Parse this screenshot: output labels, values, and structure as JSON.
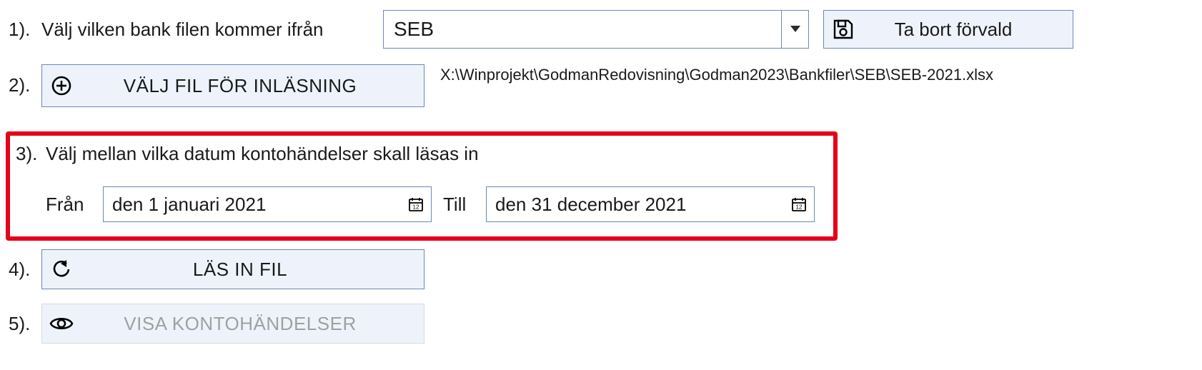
{
  "step1": {
    "num": "1).",
    "label": "Välj vilken bank filen kommer ifrån",
    "bank_value": "SEB",
    "remove_btn": "Ta bort förvald"
  },
  "step2": {
    "num": "2).",
    "choose_btn": "VÄLJ FIL FÖR INLÄSNING",
    "filepath": "X:\\Winprojekt\\GodmanRedovisning\\Godman2023\\Bankfiler\\SEB\\SEB-2021.xlsx"
  },
  "step3": {
    "num": "3).",
    "title": "Välj mellan vilka datum kontohändelser skall läsas in",
    "from_label": "Från",
    "from_value": "den 1 januari 2021",
    "to_label": "Till",
    "to_value": "den 31 december 2021"
  },
  "step4": {
    "num": "4).",
    "read_btn": "LÄS IN FIL"
  },
  "step5": {
    "num": "5).",
    "show_btn": "VISA KONTOHÄNDELSER"
  }
}
